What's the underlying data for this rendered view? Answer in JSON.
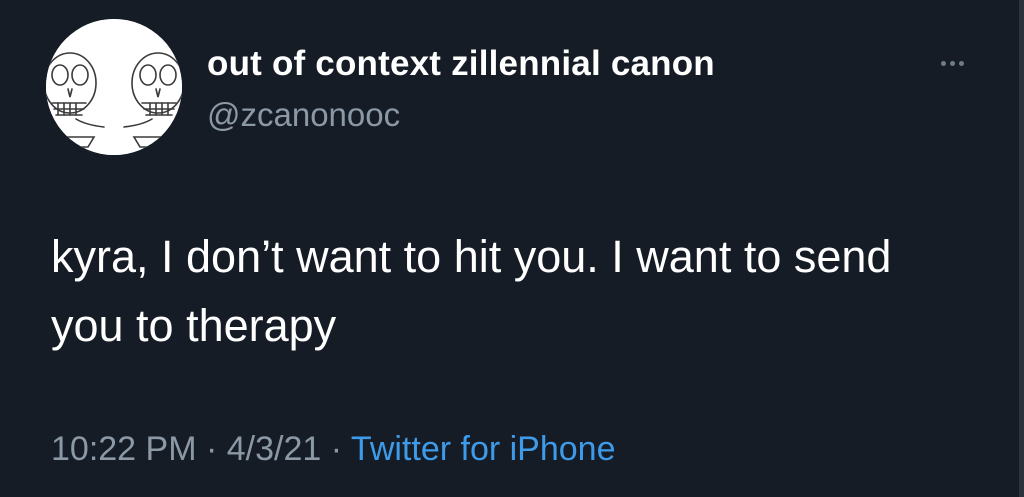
{
  "tweet": {
    "author": {
      "display_name": "out of context zillennial canon",
      "handle": "@zcanonooc",
      "avatar_icon": "skeleton-sketch-avatar"
    },
    "more_icon": "more-options-icon",
    "text": "kyra, I don’t want to hit you. I want to send you to therapy",
    "time": "10:22 PM",
    "date": "4/3/21",
    "separator": "·",
    "source": "Twitter for iPhone"
  },
  "colors": {
    "background": "#151c26",
    "primary_text": "#ffffff",
    "secondary_text": "#8b98a5",
    "link": "#3d9be9"
  }
}
